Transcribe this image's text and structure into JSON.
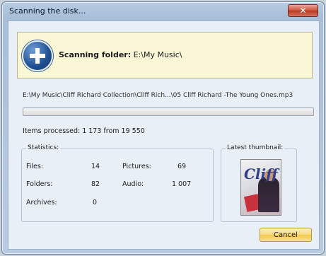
{
  "window": {
    "title": "Scanning the disk...",
    "close_label": "✕"
  },
  "banner": {
    "label": "Scanning folder:",
    "folder": "E:\\My Music\\"
  },
  "current_path": "E:\\My Music\\Cliff Richard Collection\\Cliff Rich...\\05 Cliff Richard -The Young Ones.mp3",
  "progress": {
    "fraction": 0.0
  },
  "items_processed": "Items processed: 1 173 from 19 550",
  "statistics": {
    "label": "Statistics:",
    "files_label": "Files:",
    "files_value": "14",
    "folders_label": "Folders:",
    "folders_value": "82",
    "archives_label": "Archives:",
    "archives_value": "0",
    "pictures_label": "Pictures:",
    "pictures_value": "69",
    "audio_label": "Audio:",
    "audio_value": "1 007"
  },
  "thumbnail": {
    "label": "Latest thumbnail:",
    "cover_script": "Cliff"
  },
  "cancel_label": "Cancel"
}
